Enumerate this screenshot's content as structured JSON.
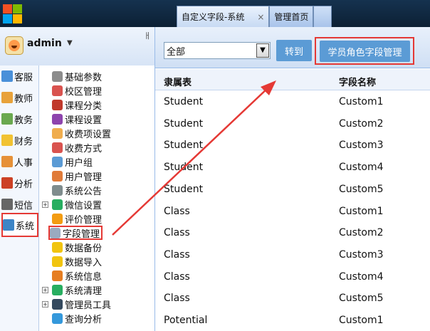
{
  "tabs": [
    {
      "label": "自定义字段-系统",
      "close": "×",
      "active": true
    },
    {
      "label": "管理首页",
      "active": false
    }
  ],
  "user": {
    "name": "admin",
    "caret": "▼",
    "pin": "ㅐ"
  },
  "sidenav": [
    {
      "label": "客服",
      "color": "#4a90d9"
    },
    {
      "label": "教师",
      "color": "#e8a23a"
    },
    {
      "label": "教务",
      "color": "#6aa84f"
    },
    {
      "label": "财务",
      "color": "#f1c232"
    },
    {
      "label": "人事",
      "color": "#e69138"
    },
    {
      "label": "分析",
      "color": "#cc4125"
    },
    {
      "label": "短信",
      "color": "#666666"
    },
    {
      "label": "系统",
      "color": "#3d85c6",
      "selected": true
    }
  ],
  "tree": [
    {
      "label": "基础参数",
      "icon": "gear-icon",
      "color": "#8c8c8c",
      "expandable": false
    },
    {
      "label": "校区管理",
      "icon": "globe-icon",
      "color": "#d9534f",
      "expandable": false
    },
    {
      "label": "课程分类",
      "icon": "books-icon",
      "color": "#c0392b",
      "expandable": false
    },
    {
      "label": "课程设置",
      "icon": "book-icon",
      "color": "#8e44ad",
      "expandable": false
    },
    {
      "label": "收费项设置",
      "icon": "coins-icon",
      "color": "#f0ad4e",
      "expandable": false
    },
    {
      "label": "收费方式",
      "icon": "cards-icon",
      "color": "#d9534f",
      "expandable": false
    },
    {
      "label": "用户组",
      "icon": "users-icon",
      "color": "#5b9bd5",
      "expandable": false
    },
    {
      "label": "用户管理",
      "icon": "user-icon",
      "color": "#e07b39",
      "expandable": false
    },
    {
      "label": "系统公告",
      "icon": "notice-icon",
      "color": "#7f8c8d",
      "expandable": false
    },
    {
      "label": "微信设置",
      "icon": "wechat-icon",
      "color": "#27ae60",
      "expandable": true
    },
    {
      "label": "评价管理",
      "icon": "star-icon",
      "color": "#f39c12",
      "expandable": false
    },
    {
      "label": "字段管理",
      "icon": "field-icon",
      "color": "#9aaac0",
      "expandable": false,
      "selected": true
    },
    {
      "label": "数据备份",
      "icon": "database-icon",
      "color": "#f1c40f",
      "expandable": false
    },
    {
      "label": "数据导入",
      "icon": "import-icon",
      "color": "#f1c40f",
      "expandable": false
    },
    {
      "label": "系统信息",
      "icon": "info-icon",
      "color": "#e67e22",
      "expandable": false
    },
    {
      "label": "系统清理",
      "icon": "recycle-icon",
      "color": "#27ae60",
      "expandable": true
    },
    {
      "label": "管理员工具",
      "icon": "tools-icon",
      "color": "#34495e",
      "expandable": true
    },
    {
      "label": "查询分析",
      "icon": "search-icon",
      "color": "#3498db",
      "expandable": false
    }
  ],
  "toolbar": {
    "select_value": "全部",
    "select_arrow": "▼",
    "goto_label": "转到",
    "role_fields_label": "学员角色字段管理"
  },
  "table": {
    "headers": [
      "隶属表",
      "字段名称"
    ],
    "rows": [
      [
        "Student",
        "Custom1"
      ],
      [
        "Student",
        "Custom2"
      ],
      [
        "Student",
        "Custom3"
      ],
      [
        "Student",
        "Custom4"
      ],
      [
        "Student",
        "Custom5"
      ],
      [
        "Class",
        "Custom1"
      ],
      [
        "Class",
        "Custom2"
      ],
      [
        "Class",
        "Custom3"
      ],
      [
        "Class",
        "Custom4"
      ],
      [
        "Class",
        "Custom5"
      ],
      [
        "Potential",
        "Custom1"
      ]
    ]
  },
  "colors": {
    "accent_button": "#5b9bd5",
    "highlight": "#e53935"
  }
}
